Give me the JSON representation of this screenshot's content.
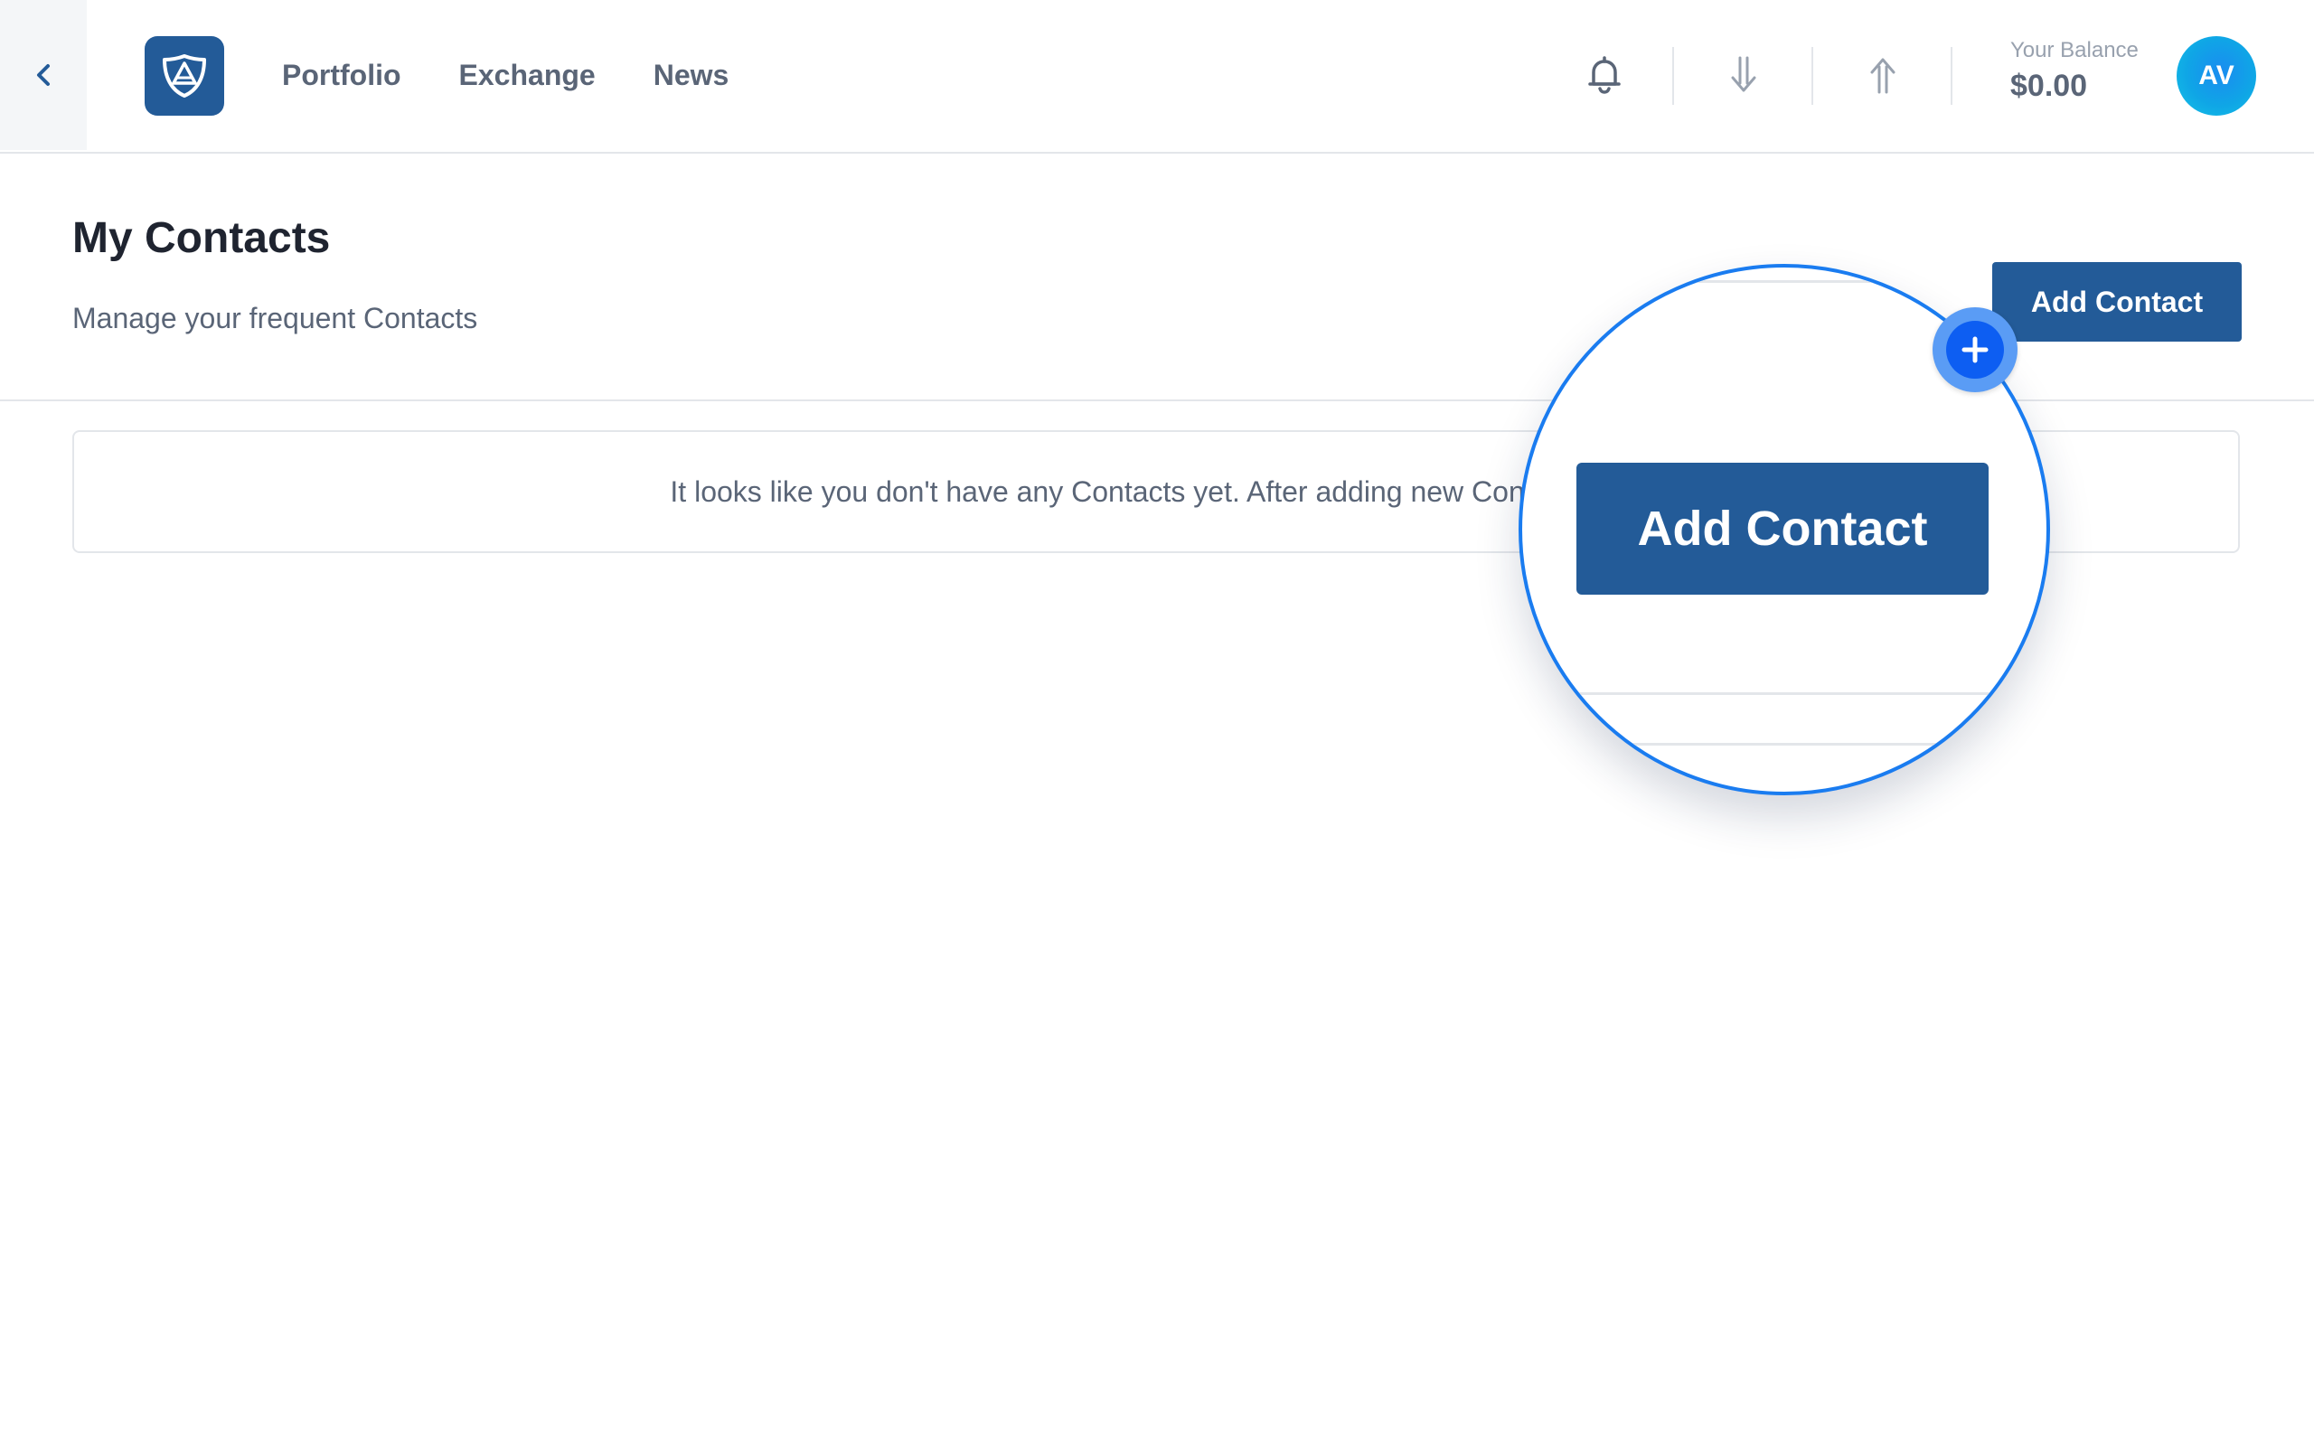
{
  "header": {
    "nav": [
      {
        "label": "Portfolio"
      },
      {
        "label": "Exchange"
      },
      {
        "label": "News"
      }
    ],
    "balance_label": "Your Balance",
    "balance_value": "$0.00",
    "avatar_initials": "AV"
  },
  "page": {
    "title": "My Contacts",
    "subtitle": "Manage your frequent Contacts",
    "add_button_label": "Add Contact",
    "empty_message": "It looks like you don't have any Contacts yet. After adding new Contacts, the"
  },
  "magnifier": {
    "button_label": "Add Contact"
  },
  "colors": {
    "brand": "#235b98",
    "accent": "#1a7cf0",
    "text_muted": "#5a6577"
  },
  "icons": [
    "back-chevron-icon",
    "shield-logo-icon",
    "bell-icon",
    "receive-arrow-icon",
    "send-arrow-icon",
    "plus-icon"
  ]
}
